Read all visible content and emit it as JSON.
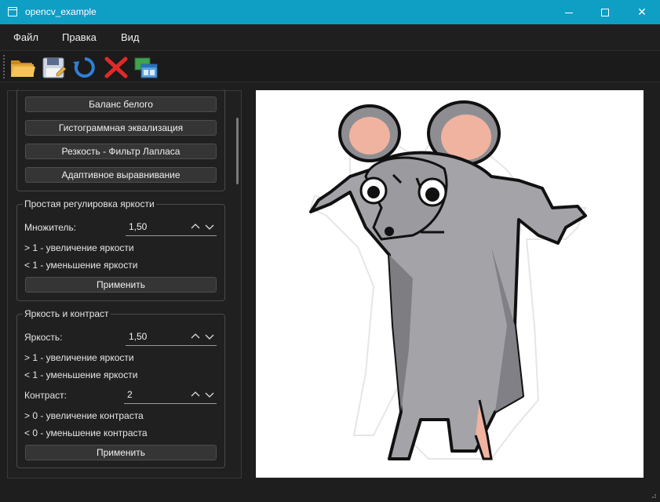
{
  "window": {
    "title": "opencv_example",
    "controls": {
      "minimize": "minimize",
      "maximize": "maximize",
      "close": "✕"
    }
  },
  "menu": {
    "items": [
      "Файл",
      "Правка",
      "Вид"
    ]
  },
  "toolbar": {
    "buttons": [
      {
        "icon": "folder-open-icon"
      },
      {
        "icon": "save-icon"
      },
      {
        "icon": "refresh-icon"
      },
      {
        "icon": "delete-icon"
      },
      {
        "icon": "windows-icon"
      }
    ]
  },
  "filters": {
    "buttons": [
      "Баланс белого",
      "Гистограммная эквализация",
      "Резкость - Фильтр Лапласа",
      "Адаптивное выравнивание"
    ]
  },
  "simple_brightness": {
    "title": "Простая регулировка яркости",
    "multiplier_label": "Множитель:",
    "multiplier_value": "1,50",
    "hint_increase": "> 1 - увеличение яркости",
    "hint_decrease": "< 1 - уменьшение яркости",
    "apply": "Применить"
  },
  "brightness_contrast": {
    "title": "Яркость и контраст",
    "brightness_label": "Яркость:",
    "brightness_value": "1,50",
    "brightness_hint_increase": "> 1 - увеличение яркости",
    "brightness_hint_decrease": "< 1 - уменьшение яркости",
    "contrast_label": "Контраст:",
    "contrast_value": "2",
    "contrast_hint_increase": "> 0 - увеличение контраста",
    "contrast_hint_decrease": "< 0 - уменьшение контраста",
    "apply": "Применить"
  },
  "colors": {
    "titlebar": "#0f9ec4",
    "background": "#1e1e1e",
    "panel": "#202020",
    "button": "#353535"
  }
}
